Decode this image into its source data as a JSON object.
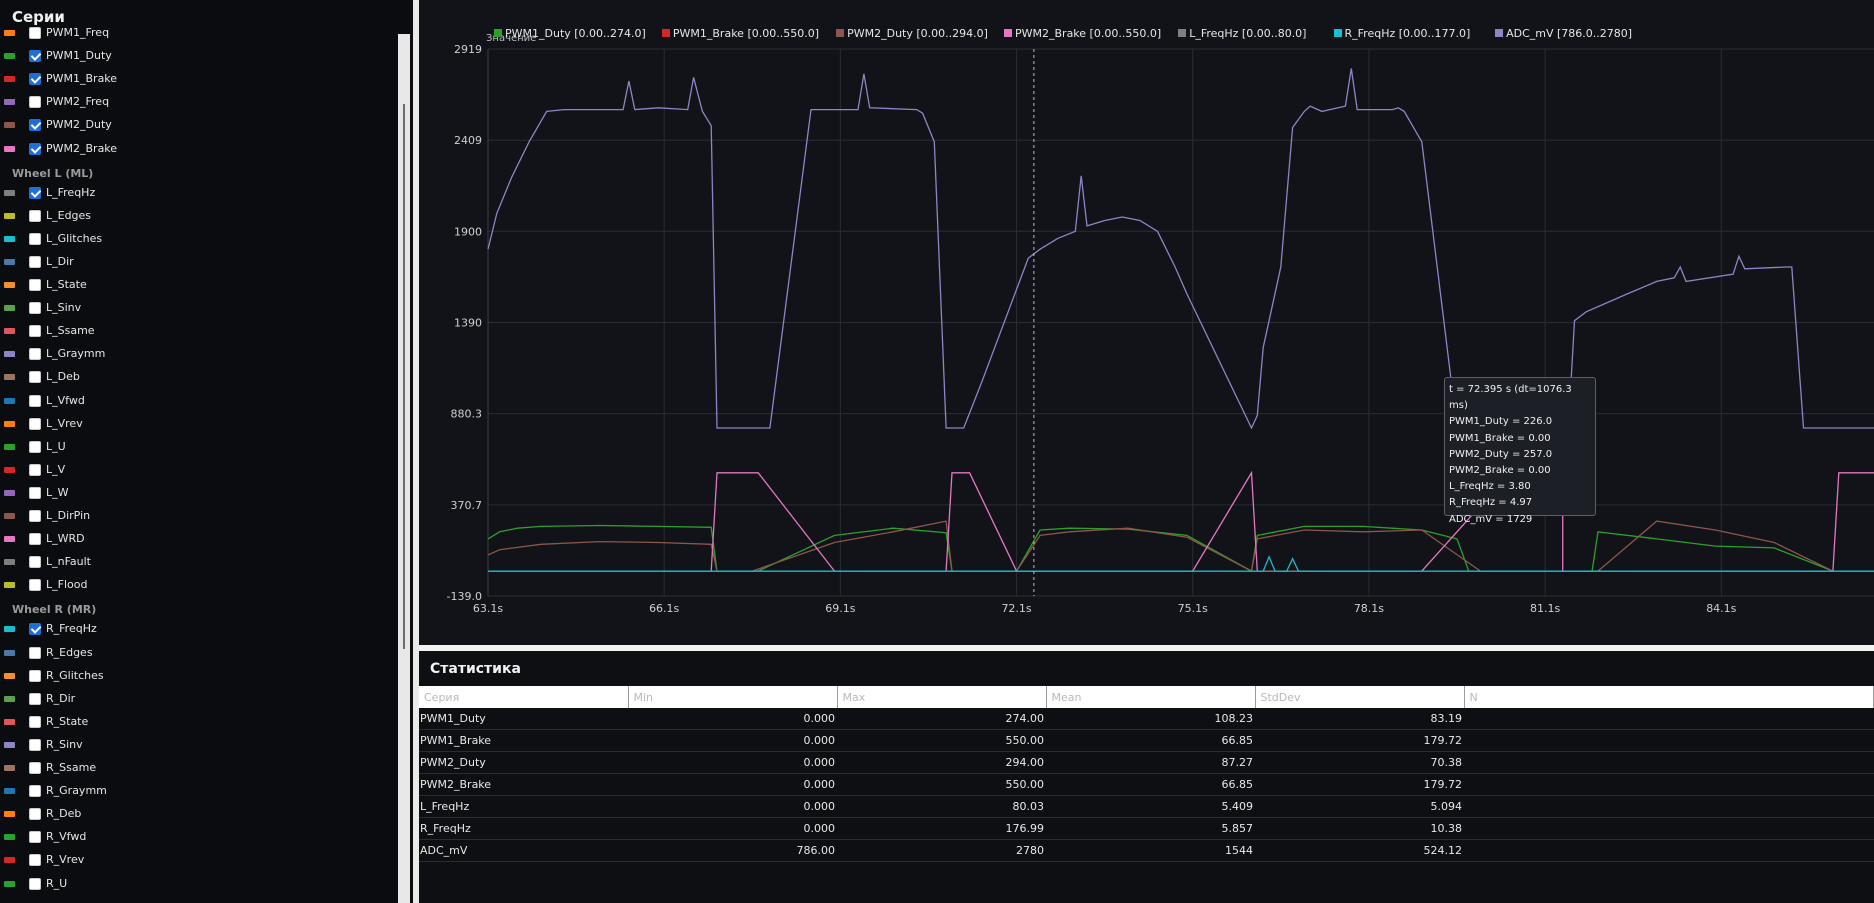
{
  "sidebar": {
    "title": "Серии",
    "rows": [
      {
        "label": "PWM1_Freq",
        "color": "#ff7f0e",
        "checked": false
      },
      {
        "label": "PWM1_Duty",
        "color": "#2ca02c",
        "checked": true
      },
      {
        "label": "PWM1_Brake",
        "color": "#d62728",
        "checked": true
      },
      {
        "label": "PWM2_Freq",
        "color": "#9467bd",
        "checked": false
      },
      {
        "label": "PWM2_Duty",
        "color": "#8c564b",
        "checked": true
      },
      {
        "label": "PWM2_Brake",
        "color": "#e377c2",
        "checked": true
      },
      {
        "group": "Wheel L (ML)"
      },
      {
        "label": "L_FreqHz",
        "color": "#7f7f7f",
        "checked": true
      },
      {
        "label": "L_Edges",
        "color": "#bcbd22",
        "checked": false
      },
      {
        "label": "L_Glitches",
        "color": "#17becf",
        "checked": false
      },
      {
        "label": "L_Dir",
        "color": "#4e79a7",
        "checked": false
      },
      {
        "label": "L_State",
        "color": "#f28e2b",
        "checked": false
      },
      {
        "label": "L_Sinv",
        "color": "#59a14f",
        "checked": false
      },
      {
        "label": "L_Ssame",
        "color": "#e15759",
        "checked": false
      },
      {
        "label": "L_Graymm",
        "color": "#8f84c4",
        "checked": false
      },
      {
        "label": "L_Deb",
        "color": "#9c755f",
        "checked": false
      },
      {
        "label": "L_Vfwd",
        "color": "#1f77b4",
        "checked": false
      },
      {
        "label": "L_Vrev",
        "color": "#ff7f0e",
        "checked": false
      },
      {
        "label": "L_U",
        "color": "#2ca02c",
        "checked": false
      },
      {
        "label": "L_V",
        "color": "#d62728",
        "checked": false
      },
      {
        "label": "L_W",
        "color": "#9467bd",
        "checked": false
      },
      {
        "label": "L_DirPin",
        "color": "#8c564b",
        "checked": false
      },
      {
        "label": "L_WRD",
        "color": "#e377c2",
        "checked": false
      },
      {
        "label": "L_nFault",
        "color": "#7f7f7f",
        "checked": false
      },
      {
        "label": "L_Flood",
        "color": "#bcbd22",
        "checked": false
      },
      {
        "group": "Wheel R (MR)"
      },
      {
        "label": "R_FreqHz",
        "color": "#17becf",
        "checked": true
      },
      {
        "label": "R_Edges",
        "color": "#4e79a7",
        "checked": false
      },
      {
        "label": "R_Glitches",
        "color": "#f28e2b",
        "checked": false
      },
      {
        "label": "R_Dir",
        "color": "#59a14f",
        "checked": false
      },
      {
        "label": "R_State",
        "color": "#e15759",
        "checked": false
      },
      {
        "label": "R_Sinv",
        "color": "#8f84c4",
        "checked": false
      },
      {
        "label": "R_Ssame",
        "color": "#9c755f",
        "checked": false
      },
      {
        "label": "R_Graymm",
        "color": "#1f77b4",
        "checked": false
      },
      {
        "label": "R_Deb",
        "color": "#ff7f0e",
        "checked": false
      },
      {
        "label": "R_Vfwd",
        "color": "#2ca02c",
        "checked": false
      },
      {
        "label": "R_Vrev",
        "color": "#d62728",
        "checked": false
      },
      {
        "label": "R_U",
        "color": "#2ca02c",
        "checked": false
      }
    ]
  },
  "chart_data": {
    "type": "line",
    "ylabel_overlay": "Значение",
    "xlim": [
      63.1,
      86.7
    ],
    "ylim": [
      -139.0,
      2919
    ],
    "x_ticks": [
      "63.1s",
      "66.1s",
      "69.1s",
      "72.1s",
      "75.1s",
      "78.1s",
      "81.1s",
      "84.1s"
    ],
    "x_tick_values": [
      63.1,
      66.1,
      69.1,
      72.1,
      75.1,
      78.1,
      81.1,
      84.1
    ],
    "y_ticks": [
      "2919",
      "2409",
      "1900",
      "1390",
      "880.3",
      "370.7",
      "-139.0"
    ],
    "y_tick_values": [
      2919,
      2409,
      1900,
      1390,
      880.3,
      370.7,
      -139.0
    ],
    "grid": true,
    "legend_position": "top",
    "legend": [
      {
        "text": "PWM1_Duty [0.00..274.0]",
        "color": "#2ca02c"
      },
      {
        "text": "PWM1_Brake [0.00..550.0]",
        "color": "#d62728"
      },
      {
        "text": "PWM2_Duty [0.00..294.0]",
        "color": "#8c564b"
      },
      {
        "text": "PWM2_Brake [0.00..550.0]",
        "color": "#e377c2"
      },
      {
        "text": "L_FreqHz [0.00..80.0]",
        "color": "#7f7f7f"
      },
      {
        "text": "R_FreqHz [0.00..177.0]",
        "color": "#17becf"
      },
      {
        "text": "ADC_mV [786.0..2780]",
        "color": "#8f84c4"
      }
    ],
    "cursor_t": 72.395,
    "series": [
      {
        "name": "ADC_mV",
        "color": "#8f84c4",
        "x": [
          63.1,
          63.25,
          63.5,
          63.8,
          64.1,
          64.4,
          65.0,
          65.4,
          65.5,
          65.6,
          66.0,
          66.5,
          66.6,
          66.75,
          66.9,
          67.0,
          67.3,
          67.8,
          67.9,
          68.6,
          69.0,
          69.4,
          69.5,
          69.6,
          70.4,
          70.5,
          70.7,
          70.9,
          71.2,
          71.5,
          72.3,
          72.5,
          72.8,
          73.1,
          73.2,
          73.3,
          73.6,
          73.9,
          74.2,
          74.5,
          74.8,
          75.0,
          76.1,
          76.2,
          76.3,
          76.6,
          76.8,
          77.0,
          77.1,
          77.3,
          77.7,
          77.8,
          77.9,
          78.5,
          78.6,
          78.7,
          79.0,
          79.6,
          79.7,
          80.0,
          81.4,
          81.5,
          81.6,
          81.8,
          82.5,
          83.0,
          83.3,
          83.4,
          83.5,
          84.3,
          84.4,
          84.5,
          85.2,
          85.3,
          85.5,
          86.7
        ],
        "y": [
          1800,
          2000,
          2200,
          2400,
          2570,
          2580,
          2580,
          2580,
          2740,
          2580,
          2590,
          2580,
          2760,
          2570,
          2490,
          800,
          800,
          800,
          800,
          2580,
          2580,
          2580,
          2780,
          2590,
          2580,
          2560,
          2400,
          800,
          800,
          1050,
          1750,
          1800,
          1860,
          1900,
          2210,
          1930,
          1960,
          1980,
          1960,
          1900,
          1700,
          1550,
          800,
          870,
          1250,
          1700,
          2480,
          2570,
          2600,
          2570,
          2600,
          2810,
          2580,
          2580,
          2590,
          2570,
          2400,
          800,
          800,
          800,
          800,
          820,
          1400,
          1450,
          1550,
          1620,
          1640,
          1700,
          1620,
          1660,
          1760,
          1690,
          1700,
          1700,
          800,
          800
        ]
      },
      {
        "name": "PWM1_Duty",
        "color": "#2ca02c",
        "x": [
          63.1,
          63.3,
          63.6,
          64.0,
          65.0,
          66.0,
          66.9,
          67.0,
          67.7,
          69.0,
          70.0,
          70.9,
          71.0,
          72.1,
          72.5,
          73.0,
          74.0,
          75.0,
          76.1,
          76.2,
          77.0,
          78.0,
          79.0,
          79.6,
          79.8,
          81.0,
          81.9,
          82.0,
          83.0,
          84.0,
          85.0,
          86.0,
          86.7
        ],
        "y": [
          180,
          220,
          240,
          250,
          255,
          250,
          245,
          0,
          0,
          200,
          240,
          215,
          0,
          0,
          230,
          240,
          235,
          200,
          0,
          200,
          250,
          250,
          230,
          180,
          0,
          0,
          0,
          220,
          180,
          140,
          130,
          0,
          0
        ]
      },
      {
        "name": "PWM2_Duty",
        "color": "#8c564b",
        "x": [
          63.1,
          63.3,
          64.0,
          65.0,
          66.0,
          66.9,
          67.0,
          67.6,
          69.0,
          70.0,
          70.9,
          71.0,
          72.1,
          72.5,
          73.0,
          74.0,
          75.0,
          76.1,
          76.2,
          77.0,
          78.0,
          79.0,
          80.0,
          81.9,
          82.0,
          83.0,
          84.0,
          85.0,
          86.0,
          86.7
        ],
        "y": [
          90,
          120,
          150,
          165,
          160,
          150,
          0,
          0,
          160,
          220,
          280,
          0,
          0,
          200,
          220,
          240,
          190,
          0,
          180,
          230,
          220,
          230,
          0,
          0,
          0,
          280,
          230,
          160,
          0,
          0
        ]
      },
      {
        "name": "PWM2_Brake",
        "color": "#e377c2",
        "x": [
          63.1,
          66.9,
          67.0,
          67.7,
          69.0,
          70.9,
          71.0,
          71.3,
          72.1,
          75.1,
          76.1,
          76.2,
          77.0,
          79.0,
          80.5,
          81.4,
          81.4,
          82.0,
          86.0,
          86.1,
          86.7
        ],
        "y": [
          0,
          0,
          550,
          550,
          0,
          0,
          550,
          550,
          0,
          0,
          550,
          0,
          0,
          0,
          550,
          550,
          0,
          0,
          0,
          550,
          550
        ]
      },
      {
        "name": "L_FreqHz",
        "color": "#7f7f7f",
        "x": [
          63.1,
          86.7
        ],
        "y": [
          0,
          0
        ]
      },
      {
        "name": "R_FreqHz",
        "color": "#17becf",
        "x": [
          63.1,
          76.3,
          76.4,
          76.5,
          76.7,
          76.8,
          76.9,
          86.7
        ],
        "y": [
          0,
          0,
          80,
          0,
          0,
          70,
          0,
          0
        ]
      }
    ]
  },
  "tooltip": {
    "lines": [
      "t = 72.395 s  (dt=1076.3 ms)",
      "PWM1_Duty = 226.0",
      "PWM1_Brake = 0.00",
      "PWM2_Duty = 257.0",
      "PWM2_Brake = 0.00",
      "L_FreqHz = 3.80",
      "R_FreqHz = 4.97",
      "ADC_mV = 1729"
    ]
  },
  "stats": {
    "title": "Статистика",
    "headers": [
      "Серия",
      "Min",
      "Max",
      "Mean",
      "StdDev",
      "N"
    ],
    "rows": [
      [
        "PWM1_Duty",
        "0.000",
        "274.00",
        "108.23",
        "83.19",
        ""
      ],
      [
        "PWM1_Brake",
        "0.000",
        "550.00",
        "66.85",
        "179.72",
        ""
      ],
      [
        "PWM2_Duty",
        "0.000",
        "294.00",
        "87.27",
        "70.38",
        ""
      ],
      [
        "PWM2_Brake",
        "0.000",
        "550.00",
        "66.85",
        "179.72",
        ""
      ],
      [
        "L_FreqHz",
        "0.000",
        "80.03",
        "5.409",
        "5.094",
        ""
      ],
      [
        "R_FreqHz",
        "0.000",
        "176.99",
        "5.857",
        "10.38",
        ""
      ],
      [
        "ADC_mV",
        "786.00",
        "2780",
        "1544",
        "524.12",
        ""
      ]
    ]
  }
}
